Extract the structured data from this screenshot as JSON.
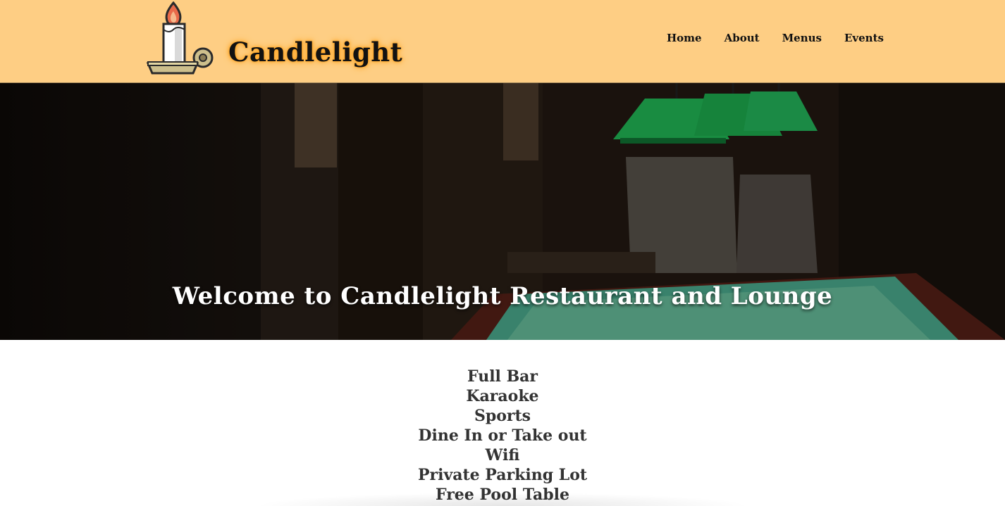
{
  "brand": {
    "name": "Candlelight",
    "logo_icon": "candle-icon",
    "glow_color": "#ff9f1a"
  },
  "nav": {
    "items": [
      "Home",
      "About",
      "Menus",
      "Events"
    ]
  },
  "hero": {
    "title": "Welcome to Candlelight Restaurant and Lounge"
  },
  "features": [
    "Full Bar",
    "Karaoke",
    "Sports",
    "Dine In or Take out",
    "Wifi",
    "Private Parking Lot",
    "Free Pool Table"
  ],
  "colors": {
    "header_bg": "#fece84",
    "hero_text": "#ffffff",
    "feature_text": "#333333",
    "lamp_green": "#21c35a",
    "table_felt": "#4fb596"
  }
}
